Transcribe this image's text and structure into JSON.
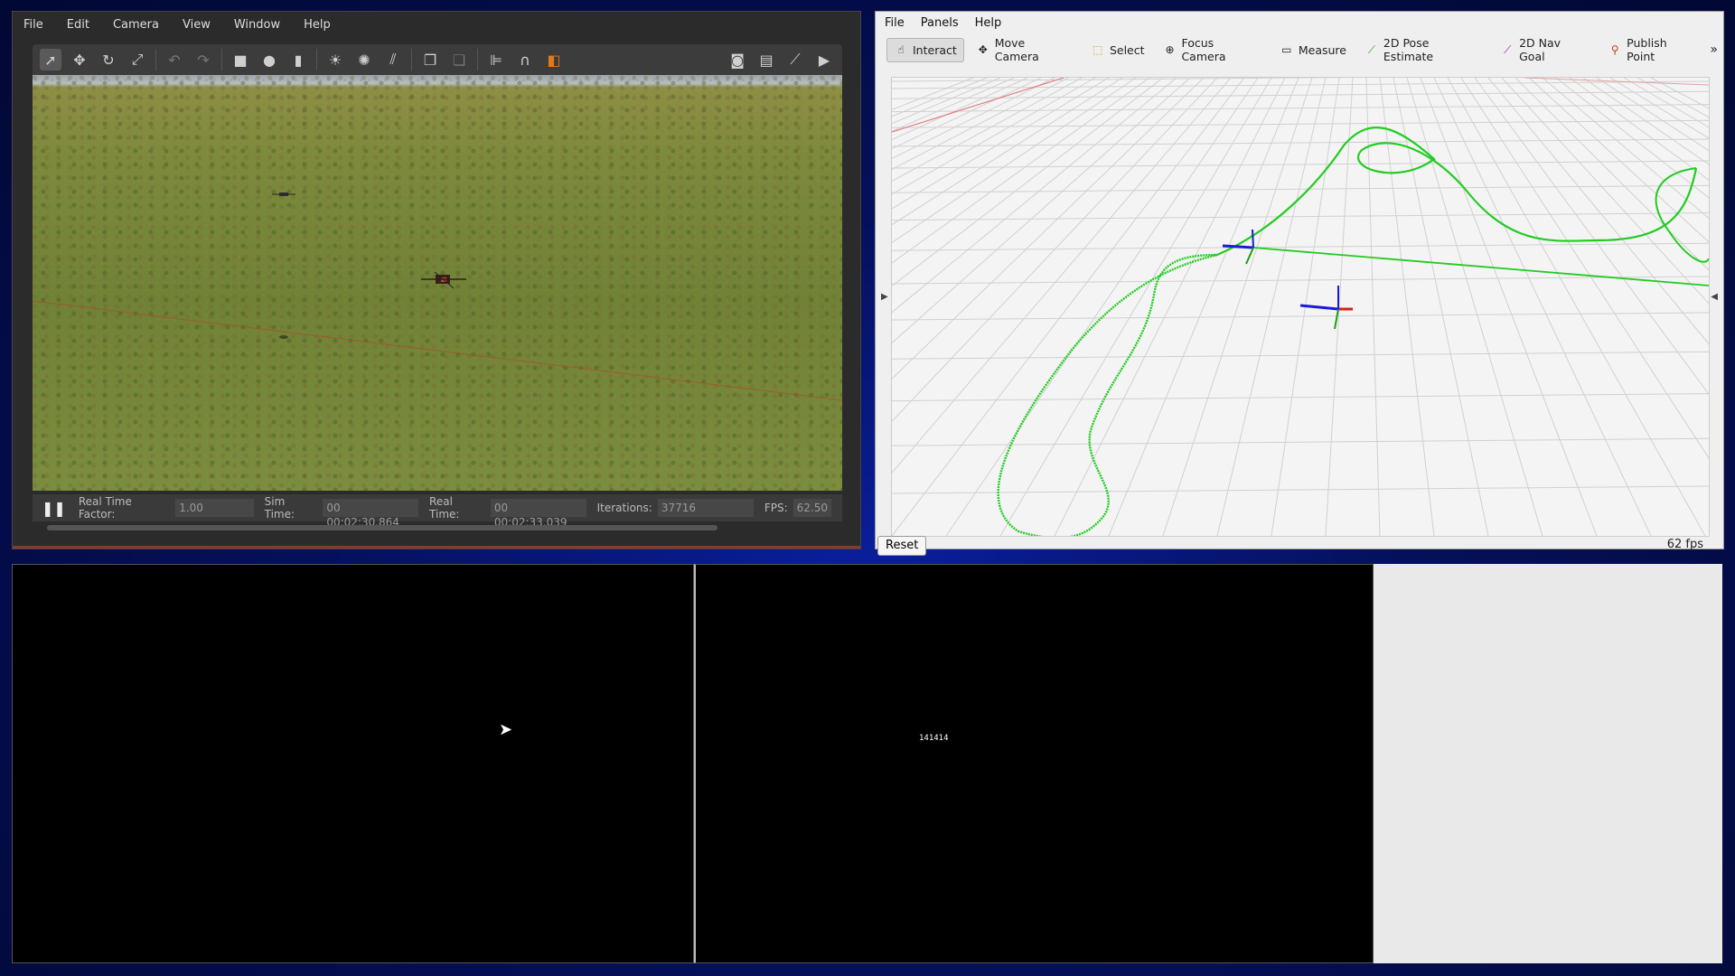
{
  "gazebo": {
    "menu": [
      "File",
      "Edit",
      "Camera",
      "View",
      "Window",
      "Help"
    ],
    "status": {
      "rtf_label": "Real Time Factor:",
      "rtf_value": "1.00",
      "sim_label": "Sim Time:",
      "sim_value": "00 00:02:30.864",
      "real_label": "Real Time:",
      "real_value": "00 00:02:33.039",
      "iter_label": "Iterations:",
      "iter_value": "37716",
      "fps_label": "FPS:",
      "fps_value": "62.50"
    },
    "toolbar_icons": [
      "select-mode-icon",
      "translate-mode-icon",
      "rotate-mode-icon",
      "scale-mode-icon",
      "undo-icon",
      "redo-icon",
      "box-icon",
      "sphere-icon",
      "cylinder-icon",
      "point-light-icon",
      "spot-light-icon",
      "directional-light-icon",
      "copy-icon",
      "paste-icon",
      "align-icon",
      "snap-icon",
      "view-angle-icon",
      "screenshot-icon",
      "log-icon",
      "plot-icon",
      "record-video-icon"
    ]
  },
  "rviz": {
    "menu": [
      "File",
      "Panels",
      "Help"
    ],
    "tools": [
      {
        "label": "Interact",
        "icon": "interact-icon",
        "active": true
      },
      {
        "label": "Move Camera",
        "icon": "move-camera-icon",
        "active": false
      },
      {
        "label": "Select",
        "icon": "select-icon",
        "active": false
      },
      {
        "label": "Focus Camera",
        "icon": "focus-camera-icon",
        "active": false
      },
      {
        "label": "Measure",
        "icon": "measure-icon",
        "active": false
      },
      {
        "label": "2D Pose Estimate",
        "icon": "pose-estimate-icon",
        "active": false
      },
      {
        "label": "2D Nav Goal",
        "icon": "nav-goal-icon",
        "active": false
      },
      {
        "label": "Publish Point",
        "icon": "publish-point-icon",
        "active": false
      }
    ],
    "more": "»",
    "reset_label": "Reset",
    "fps_text": "62 fps",
    "trajectory_color": "#22cc22"
  },
  "bottom": {
    "mid_label": "141414"
  }
}
